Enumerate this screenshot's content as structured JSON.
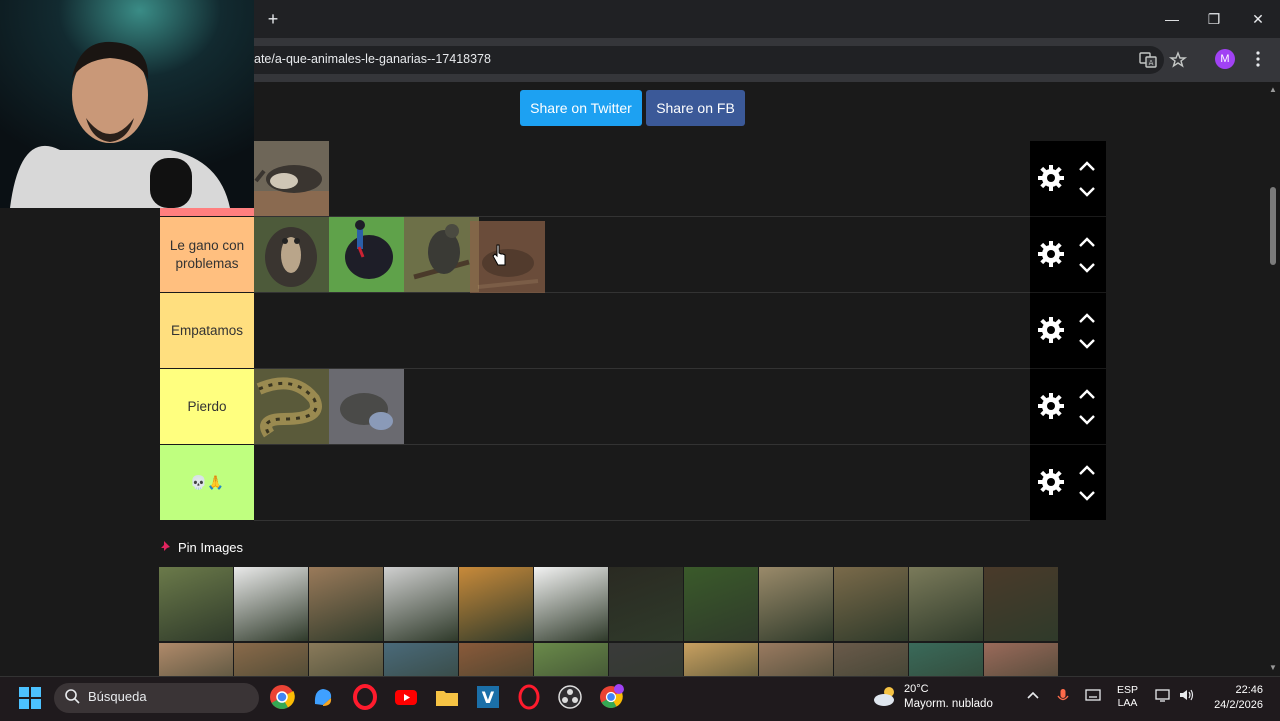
{
  "browser": {
    "new_tab_label": "+",
    "url": "ate/a-que-animales-le-ganarias--17418378",
    "avatar_letter": "M",
    "window_controls": {
      "minimize": "—",
      "restore": "❐",
      "close": "✕"
    }
  },
  "share": {
    "twitter_label": "Share on Twitter",
    "fb_label": "Share on FB"
  },
  "tiers": [
    {
      "label": "",
      "color": "#ff7f7f",
      "items": [
        "anteater"
      ]
    },
    {
      "label": "Le gano con problemas",
      "color": "#ffbf7f",
      "items": [
        "mandrill",
        "cassowary",
        "eagle",
        "dragged-animal"
      ]
    },
    {
      "label": "Empatamos",
      "color": "#ffdf7f",
      "items": []
    },
    {
      "label": "Pierdo",
      "color": "#ffff7f",
      "items": [
        "anaconda",
        "komodo-dragon"
      ]
    },
    {
      "label": "💀🙏",
      "color": "#bfff7f",
      "items": []
    }
  ],
  "pin_images": {
    "heading": "Pin Images",
    "row1": [
      "german-shepherd",
      "panda",
      "coyote",
      "snow-leopard",
      "tiger",
      "polar-bear",
      "black-bear",
      "rottweiler",
      "kangal-dog",
      "hyena",
      "wild-dog",
      "wolverine"
    ],
    "row2": [
      "animal-13",
      "cougar",
      "animal-15",
      "animal-16",
      "orangutan",
      "animal-18",
      "animal-19",
      "cheetah",
      "porcupine",
      "animal-22",
      "animal-23",
      "animal-24"
    ]
  },
  "taskbar": {
    "search_placeholder": "Búsqueda",
    "weather_temp": "20°C",
    "weather_desc": "Mayorm. nublado",
    "lang_line1": "ESP",
    "lang_line2": "LAA",
    "time": "22:46",
    "date": "24/2/2026"
  },
  "colors": {
    "twitter": "#1da1f2",
    "facebook": "#3b5998",
    "page_bg": "#1a1a1a"
  }
}
